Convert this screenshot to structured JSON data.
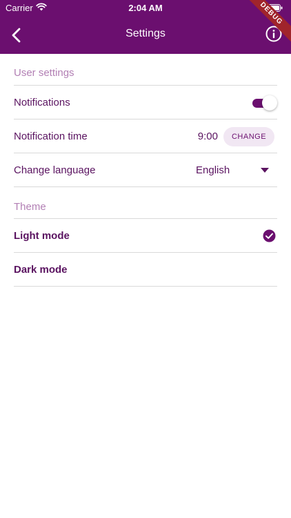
{
  "status_bar": {
    "carrier": "Carrier",
    "time": "2:04 AM"
  },
  "app_bar": {
    "title": "Settings",
    "back_icon": "chevron-left-icon",
    "info_icon": "info-icon"
  },
  "debug_banner": "DEBUG",
  "user_settings": {
    "header": "User settings",
    "notifications": {
      "label": "Notifications",
      "enabled": true
    },
    "notification_time": {
      "label": "Notification time",
      "value": "9:00",
      "button_label": "CHANGE"
    },
    "language": {
      "label": "Change language",
      "value": "English"
    }
  },
  "theme": {
    "header": "Theme",
    "light": {
      "label": "Light mode",
      "selected": true
    },
    "dark": {
      "label": "Dark mode",
      "selected": false
    }
  },
  "colors": {
    "primary": "#6b0f6f",
    "text": "#5a1360",
    "section_header": "#b27fb4",
    "divider": "#d9d9d9"
  }
}
